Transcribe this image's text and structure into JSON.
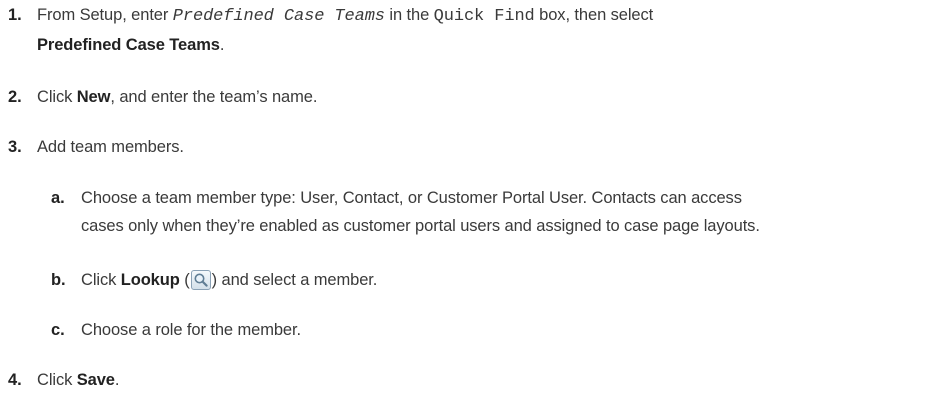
{
  "steps": {
    "s1": {
      "number": "1.",
      "prefix": "From Setup, enter ",
      "quick_find_value": "Predefined Case Teams",
      "middle": " in the ",
      "field_name": "Quick Find",
      "suffix": " box, then select",
      "selection": "Predefined Case Teams",
      "end": "."
    },
    "s2": {
      "number": "2.",
      "prefix": "Click ",
      "action": "New",
      "suffix": ", and enter the team’s name."
    },
    "s3": {
      "number": "3.",
      "text": "Add team members.",
      "sub_a": {
        "letter": "a.",
        "line1": "Choose a team member type: User, Contact, or Customer Portal User. Contacts can access",
        "line2": "cases only when they’re enabled as customer portal users and assigned to case page layouts."
      },
      "sub_b": {
        "letter": "b.",
        "prefix": "Click ",
        "action": "Lookup",
        "open_paren": " (",
        "icon": "magnifier-lookup-icon",
        "close_rest": ") and select a member."
      },
      "sub_c": {
        "letter": "c.",
        "text": "Choose a role for the member."
      }
    },
    "s4": {
      "number": "4.",
      "prefix": "Click ",
      "action": "Save",
      "suffix": "."
    }
  }
}
